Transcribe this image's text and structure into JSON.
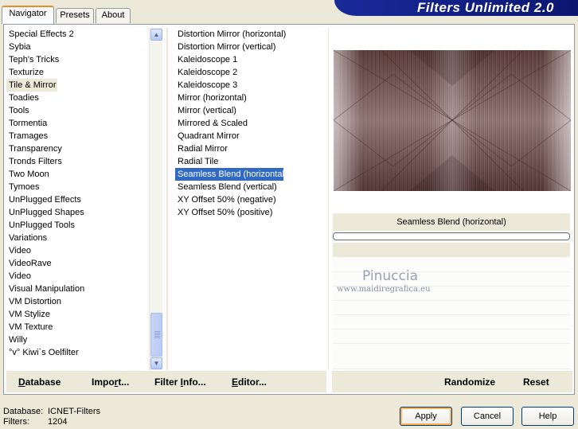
{
  "tabs": [
    {
      "label": "Navigator",
      "active": true
    },
    {
      "label": "Presets",
      "active": false
    },
    {
      "label": "About",
      "active": false
    }
  ],
  "app_title": "Filters Unlimited 2.0",
  "categories": [
    "Special Effects 2",
    "Sybia",
    "Teph's Tricks",
    "Texturize",
    "Tile & Mirror",
    "Toadies",
    "Tools",
    "Tormentia",
    "Tramages",
    "Transparency",
    "Tronds Filters",
    "Two Moon",
    "Tymoes",
    "UnPlugged Effects",
    "UnPlugged Shapes",
    "UnPlugged Tools",
    "Variations",
    "Video",
    "VideoRave",
    "Video",
    "Visual Manipulation",
    "VM Distortion",
    "VM Stylize",
    "VM Texture",
    "Willy",
    "°v° Kiwi`s Oelfilter"
  ],
  "selected_category": "Tile & Mirror",
  "filters": [
    "Distortion Mirror (horizontal)",
    "Distortion Mirror (vertical)",
    "Kaleidoscope 1",
    "Kaleidoscope 2",
    "Kaleidoscope 3",
    "Mirror (horizontal)",
    "Mirror (vertical)",
    "Mirrored & Scaled",
    "Quadrant Mirror",
    "Radial Mirror",
    "Radial Tile",
    "Seamless Blend (horizontal)",
    "Seamless Blend (vertical)",
    "XY Offset 50% (negative)",
    "XY Offset 50% (positive)"
  ],
  "selected_filter": "Seamless Blend (horizontal)",
  "preview": {
    "filter_name": "Seamless Blend (horizontal)",
    "progress": 0
  },
  "watermark": {
    "name": "Pinuccia",
    "url": "www.maidiregrafica.eu"
  },
  "toolbar": {
    "database": {
      "accel": "D",
      "rest": "atabase"
    },
    "import": {
      "pre": "Impo",
      "accel": "r",
      "rest": "t..."
    },
    "filter_info": {
      "pre": "Filter ",
      "accel": "I",
      "rest": "nfo..."
    },
    "editor": {
      "accel": "E",
      "rest": "ditor..."
    },
    "randomize": "Randomize",
    "reset": "Reset"
  },
  "status": {
    "database_label": "Database:",
    "database_value": "ICNET-Filters",
    "filters_label": "Filters:",
    "filters_value": "1204"
  },
  "buttons": {
    "apply": "Apply",
    "cancel": "Cancel",
    "help": "Help"
  },
  "colors": {
    "title_banner": "#1a2a9a",
    "selection": "#316ac5",
    "dialog_bg": "#ece9d8"
  },
  "icons": {
    "scroll_up": "chevron-up-icon",
    "scroll_down": "chevron-down-icon"
  }
}
